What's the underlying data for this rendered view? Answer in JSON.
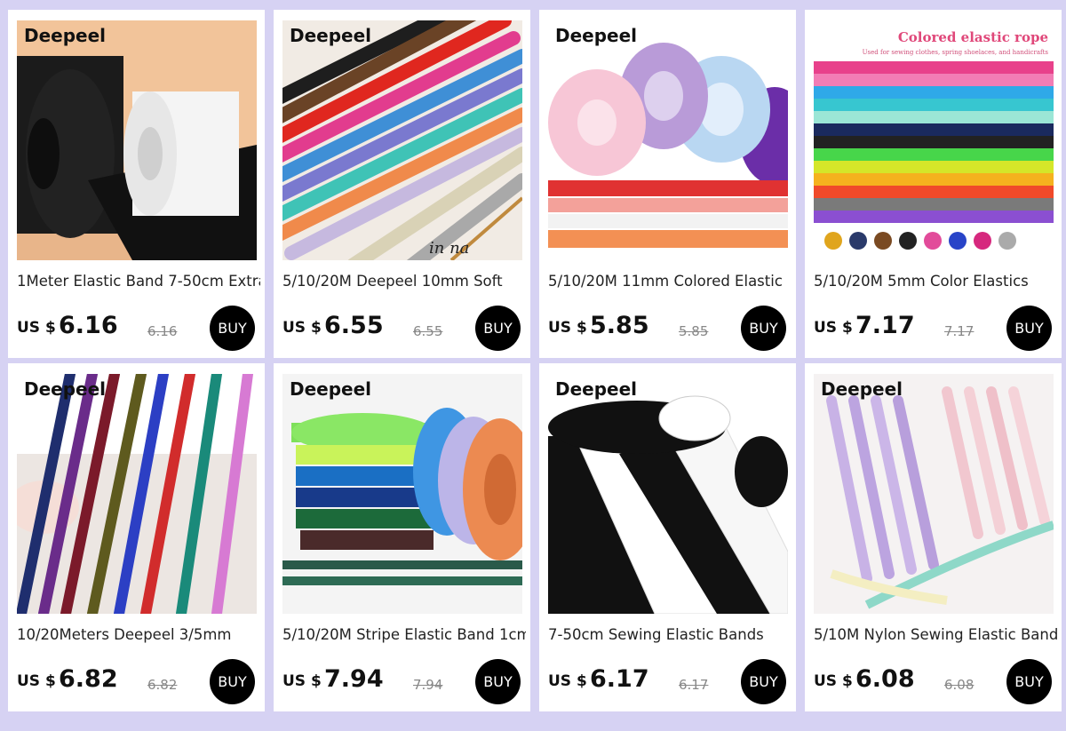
{
  "brand": "Deepeel",
  "buy_label": "BUY",
  "currency": "US $",
  "colors": {
    "background": "#d6d2f3",
    "card": "#ffffff",
    "buy_button": "#000000"
  },
  "products": [
    {
      "title": "1Meter Elastic Band 7-50cm Extra",
      "price": "6.16",
      "old_price": "6.16"
    },
    {
      "title": "5/10/20M Deepeel 10mm Soft",
      "price": "6.55",
      "old_price": "6.55",
      "photo_caption": "in na"
    },
    {
      "title": "5/10/20M 11mm Colored Elastic",
      "price": "5.85",
      "old_price": "5.85"
    },
    {
      "title": "5/10/20M 5mm Color Elastics",
      "price": "7.17",
      "old_price": "7.17",
      "photo_heading": "Colored elastic rope",
      "photo_subheading": "Used for sewing clothes, spring shoelaces, and handicrafts"
    },
    {
      "title": "10/20Meters Deepeel 3/5mm",
      "price": "6.82",
      "old_price": "6.82"
    },
    {
      "title": "5/10/20M Stripe Elastic Band 1cm",
      "price": "7.94",
      "old_price": "7.94"
    },
    {
      "title": "7-50cm Sewing Elastic Bands",
      "price": "6.17",
      "old_price": "6.17"
    },
    {
      "title": "5/10M Nylon Sewing Elastic Band",
      "price": "6.08",
      "old_price": "6.08"
    }
  ]
}
